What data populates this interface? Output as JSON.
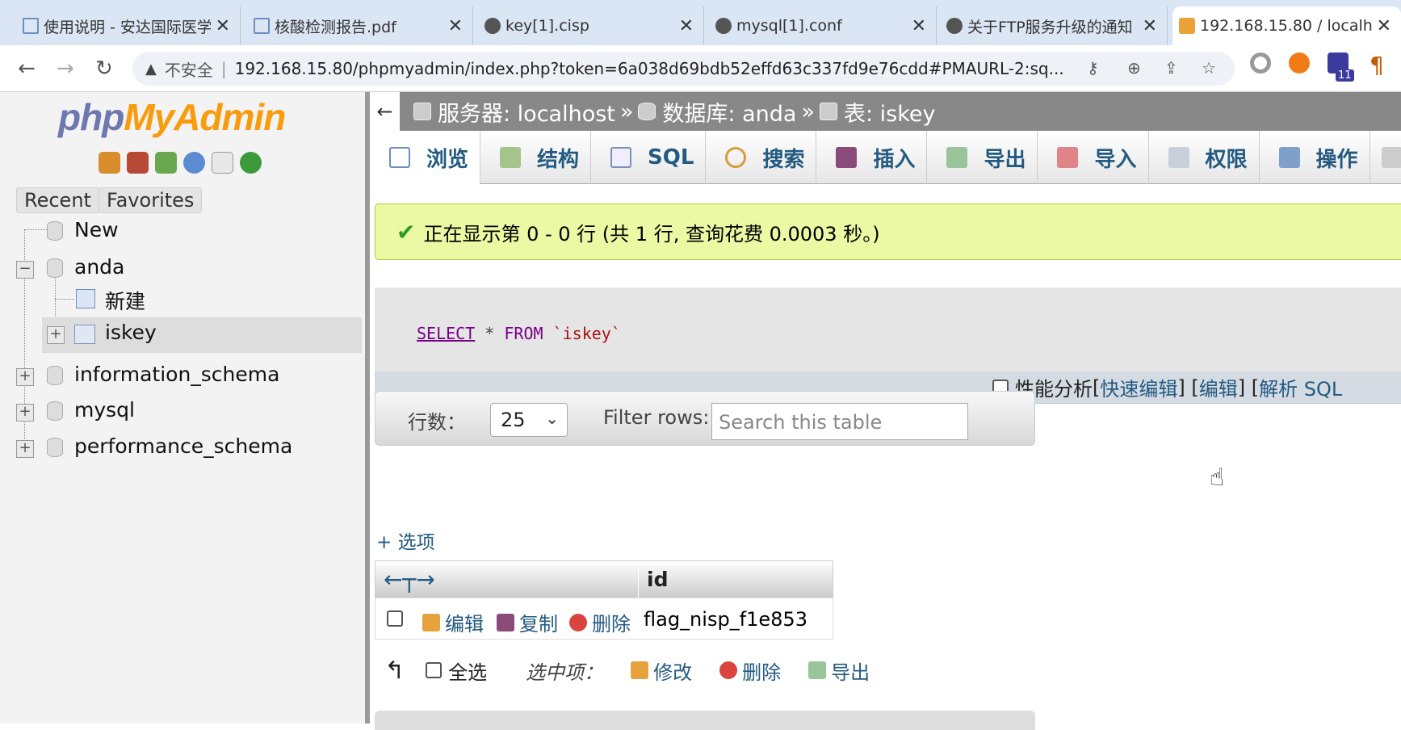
{
  "browser": {
    "tabs": [
      {
        "title": "使用说明 - 安达国际医学"
      },
      {
        "title": "核酸检测报告.pdf"
      },
      {
        "title": "key[1].cisp"
      },
      {
        "title": "mysql[1].conf"
      },
      {
        "title": "关于FTP服务升级的通知"
      },
      {
        "title": "192.168.15.80 / localh"
      }
    ],
    "insecure_label": "不安全",
    "url": "192.168.15.80/phpmyadmin/index.php?token=6a038d69bdb52effd63c337fd9e76cdd#PMAURL-2:sq...",
    "ext_badge": "11"
  },
  "sidebar": {
    "logo_part1": "php",
    "logo_part2": "MyAdmin",
    "recent_label": "Recent",
    "favorites_label": "Favorites",
    "tree": {
      "new": "New",
      "anda": "anda",
      "anda_new": "新建",
      "iskey": "iskey",
      "information_schema": "information_schema",
      "mysql": "mysql",
      "performance_schema": "performance_schema"
    }
  },
  "breadcrumb": {
    "back": "←",
    "server": "服务器: localhost",
    "sep1": "»",
    "database": "数据库: anda",
    "sep2": "»",
    "table": "表: iskey"
  },
  "menu_tabs": [
    {
      "label": "浏览"
    },
    {
      "label": "结构"
    },
    {
      "label": "SQL"
    },
    {
      "label": "搜索"
    },
    {
      "label": "插入"
    },
    {
      "label": "导出"
    },
    {
      "label": "导入"
    },
    {
      "label": "权限"
    },
    {
      "label": "操作"
    }
  ],
  "success_message": "正在显示第 0 - 0 行 (共 1 行, 查询花费 0.0003 秒。)",
  "sql": {
    "select": "SELECT",
    "mid": " * ",
    "from": "FROM",
    "table": " `iskey`"
  },
  "sql_footer": {
    "profiling": "性能分析",
    "lb1": " [ ",
    "inline_edit": "快速编辑",
    "rb1": " ] [ ",
    "edit": "编辑",
    "rb2": " ] [ ",
    "explain": "解析 SQL"
  },
  "navigation": {
    "rows_label": "行数：",
    "rows_value": "25",
    "filter_label": "Filter rows:",
    "filter_placeholder": "Search this table"
  },
  "options_link": "+ 选项",
  "results": {
    "column_header": "id",
    "rows": [
      {
        "edit": "编辑",
        "copy": "复制",
        "delete": "删除",
        "id": "flag_nisp_f1e853"
      }
    ]
  },
  "bulk": {
    "select_all": "全选",
    "with_selected": "选中项：",
    "modify": "修改",
    "delete": "删除",
    "export": "导出"
  }
}
